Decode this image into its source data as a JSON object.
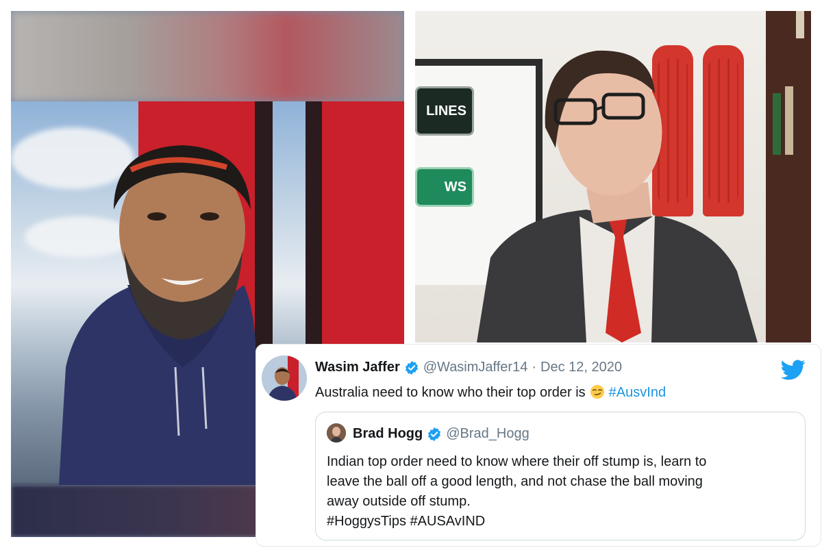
{
  "tweet": {
    "author_name": "Wasim Jaffer",
    "author_handle": "@WasimJaffer14",
    "separator": "·",
    "date": "Dec 12, 2020",
    "text_before": "Australia need to know who their top order is",
    "hashtag": "#AusvInd",
    "emoji_icon": "smirking-face-emoji",
    "quoted": {
      "author_name": "Brad Hogg",
      "author_handle": "@Brad_Hogg",
      "lines": [
        "Indian top order need to know where their off stump is, learn to",
        "leave the ball off a good length, and not chase the ball moving",
        "away outside off stump."
      ],
      "tags": "#HoggysTips #AUSAvIND"
    }
  },
  "photo_right": {
    "badge_top": "LINES",
    "badge_bottom": "WS"
  },
  "colors": {
    "twitter_blue": "#1da1f2",
    "hashtag": "#1b95e0",
    "muted": "#657786"
  }
}
